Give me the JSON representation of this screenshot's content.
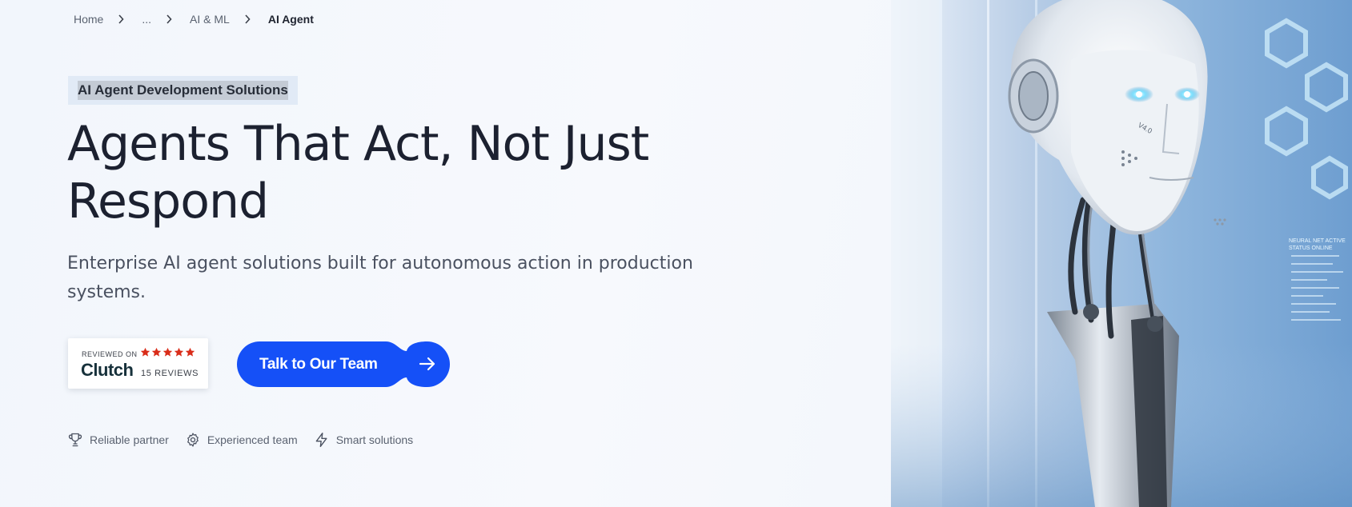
{
  "breadcrumb": {
    "items": [
      "Home",
      "...",
      "AI & ML"
    ],
    "current": "AI Agent"
  },
  "hero": {
    "eyebrow": "AI Agent Development Solutions",
    "headline_line1": "Agents That Act, Not Just",
    "headline_line2": "Respond",
    "subtitle_line1": "Enterprise AI agent solutions built for autonomous action in production",
    "subtitle_line2": "systems."
  },
  "clutch": {
    "reviewed_on": "REVIEWED ON",
    "logo": "Clutch",
    "stars": 5,
    "reviews": "15 REVIEWS"
  },
  "cta": {
    "label": "Talk to Our Team",
    "icon": "arrow-right-icon"
  },
  "features": [
    {
      "icon": "trophy-icon",
      "label": "Reliable partner"
    },
    {
      "icon": "gear-icon",
      "label": "Experienced team"
    },
    {
      "icon": "lightning-icon",
      "label": "Smart solutions"
    }
  ],
  "robot_labels": {
    "badge": "V4.0",
    "status": "NEURAL NET ACTIVE",
    "status_sub": "STATUS ONLINE"
  },
  "colors": {
    "accent": "#1550f7",
    "text_dark": "#1c2130",
    "text_muted": "#5a6270",
    "star": "#d92d1a",
    "eyebrow_bg": "#e1eaf6"
  }
}
